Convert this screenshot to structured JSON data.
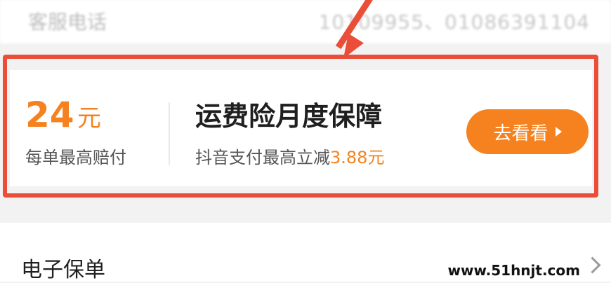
{
  "service_row": {
    "label": "客服电话",
    "value": "10109955、01086391104"
  },
  "insurance_card": {
    "amount": "24",
    "amount_unit": "元",
    "amount_caption": "每单最高赔付",
    "title": "运费险月度保障",
    "subtitle_prefix": "抖音支付最高立减",
    "subtitle_amount": "3.88元",
    "cta_label": "去看看"
  },
  "bottom_row": {
    "label": "电子保单",
    "watermark": "www.51hnjt.com"
  },
  "colors": {
    "accent": "#f5821f",
    "highlight_border": "#ea4e38"
  }
}
